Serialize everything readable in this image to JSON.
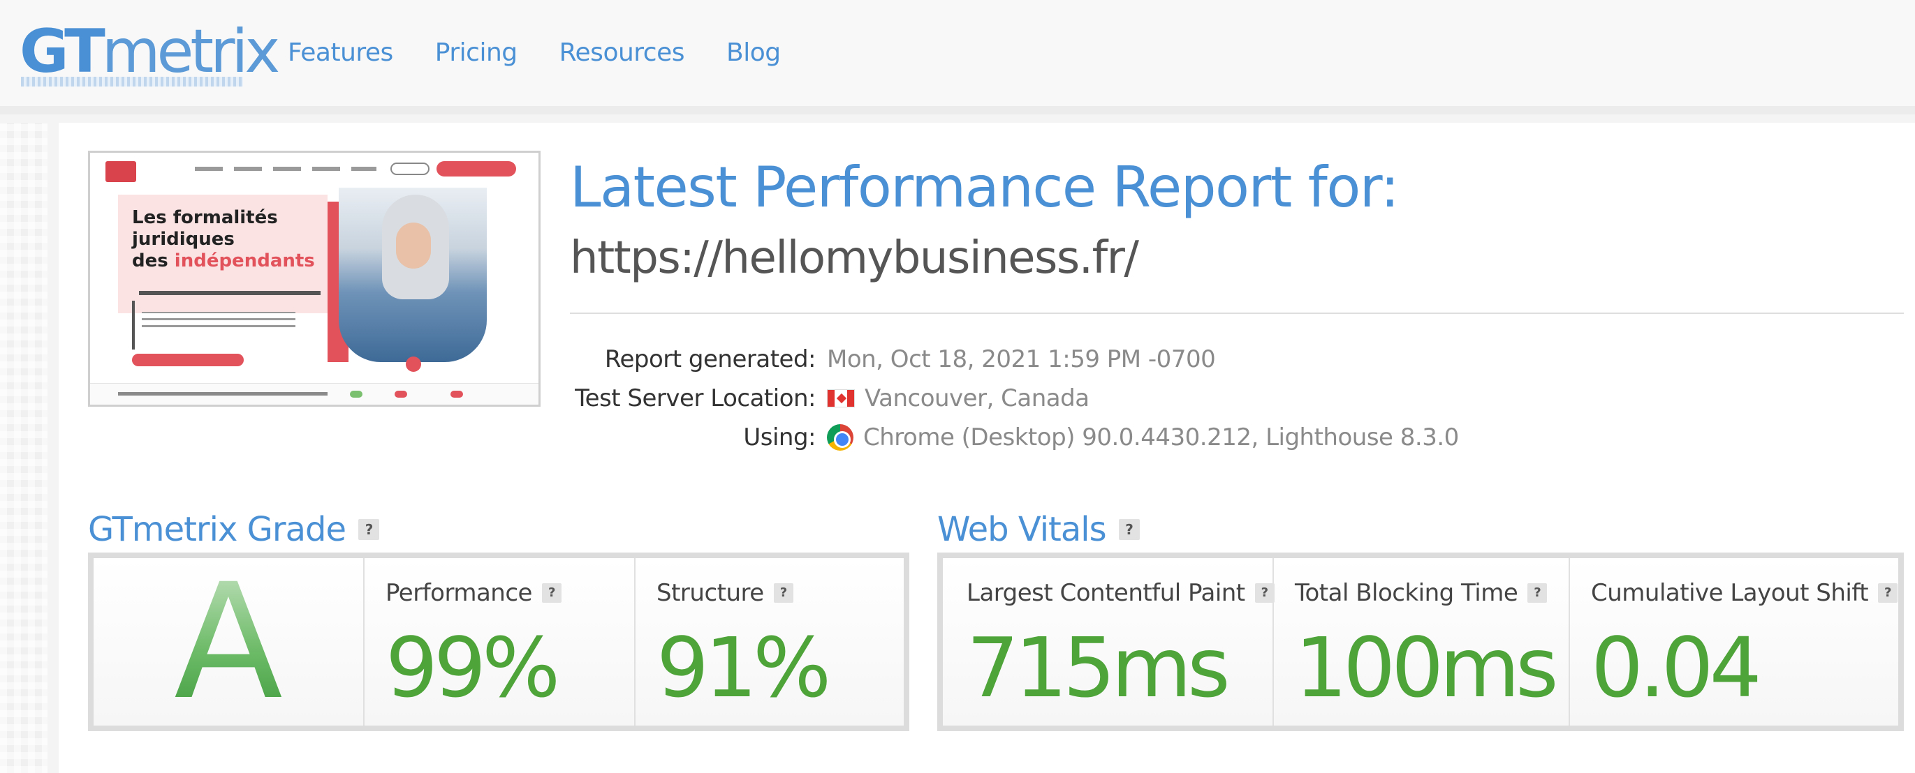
{
  "header": {
    "logo": "GTmetrix",
    "nav": [
      "Features",
      "Pricing",
      "Resources",
      "Blog"
    ]
  },
  "thumbnail": {
    "headline_line1": "Les formalités",
    "headline_line2": "juridiques",
    "headline_line3_a": "des ",
    "headline_line3_b": "indépendants"
  },
  "report": {
    "title": "Latest Performance Report for:",
    "url": "https://hellomybusiness.fr/",
    "meta": [
      {
        "label": "Report generated:",
        "value": "Mon, Oct 18, 2021 1:59 PM -0700",
        "icon": ""
      },
      {
        "label": "Test Server Location:",
        "value": "Vancouver, Canada",
        "icon": "canada-flag-icon"
      },
      {
        "label": "Using:",
        "value": "Chrome (Desktop) 90.0.4430.212, Lighthouse 8.3.0",
        "icon": "chrome-icon"
      }
    ]
  },
  "grade": {
    "title": "GTmetrix Grade",
    "help": "?",
    "letter": "A",
    "performance_label": "Performance",
    "performance_value": "99%",
    "structure_label": "Structure",
    "structure_value": "91%"
  },
  "vitals": {
    "title": "Web Vitals",
    "help": "?",
    "lcp_label": "Largest Contentful Paint",
    "lcp_value": "715ms",
    "tbt_label": "Total Blocking Time",
    "tbt_value": "100ms",
    "cls_label": "Cumulative Layout Shift",
    "cls_value": "0.04"
  },
  "colors": {
    "brand_blue": "#4a90d4",
    "grade_green": "#4ea339",
    "accent_red": "#e2525a"
  }
}
